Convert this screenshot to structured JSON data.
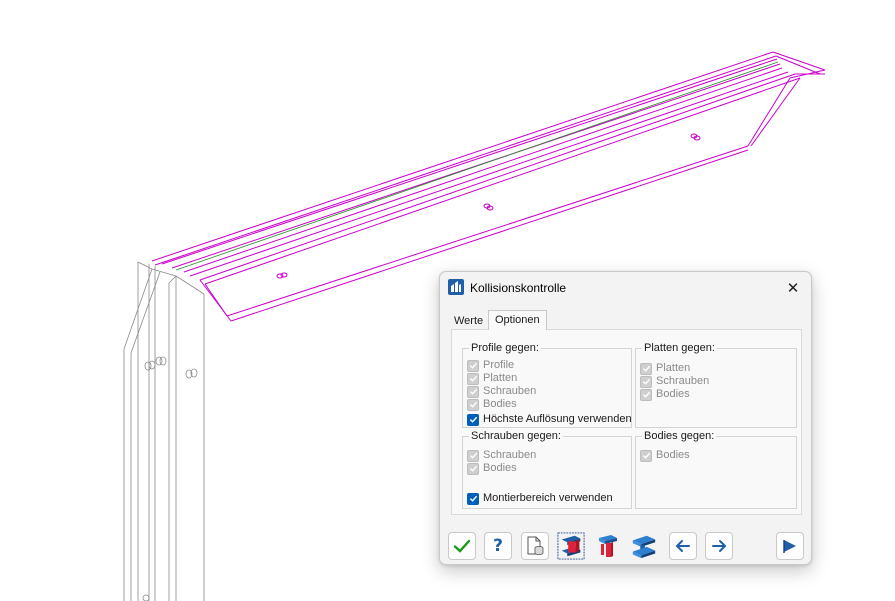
{
  "dialog": {
    "title": "Kollisionskontrolle",
    "close_glyph": "✕",
    "app_icon": "building-icon",
    "tabs": [
      {
        "label": "Werte",
        "active": false
      },
      {
        "label": "Optionen",
        "active": true
      }
    ],
    "groups": {
      "profile": {
        "title": "Profile gegen:",
        "items": [
          {
            "label": "Profile",
            "checked": true,
            "enabled": false
          },
          {
            "label": "Platten",
            "checked": true,
            "enabled": false
          },
          {
            "label": "Schrauben",
            "checked": true,
            "enabled": false
          },
          {
            "label": "Bodies",
            "checked": true,
            "enabled": false
          },
          {
            "label": "Höchste Auflösung verwenden",
            "checked": true,
            "enabled": true
          }
        ]
      },
      "platten": {
        "title": "Platten gegen:",
        "items": [
          {
            "label": "Platten",
            "checked": true,
            "enabled": false
          },
          {
            "label": "Schrauben",
            "checked": true,
            "enabled": false
          },
          {
            "label": "Bodies",
            "checked": true,
            "enabled": false
          }
        ]
      },
      "schrauben": {
        "title": "Schrauben gegen:",
        "items": [
          {
            "label": "Schrauben",
            "checked": true,
            "enabled": false
          },
          {
            "label": "Bodies",
            "checked": true,
            "enabled": false
          },
          {
            "label": "Montierbereich verwenden",
            "checked": true,
            "enabled": true
          }
        ]
      },
      "bodies": {
        "title": "Bodies gegen:",
        "items": [
          {
            "label": "Bodies",
            "checked": true,
            "enabled": false
          }
        ]
      }
    },
    "toolbar": {
      "help_label": "?",
      "buttons": [
        "ok-check-icon",
        "help-icon",
        "document-database-icon",
        "select-profile-red-icon",
        "bolt-icon",
        "select-profile-blue-icon",
        "arrow-left-icon",
        "arrow-right-icon",
        "flag-arrow-icon"
      ]
    }
  },
  "colors": {
    "highlight_magenta": "#cc00cc",
    "accent_blue": "#005fb8",
    "ok_green": "#1a9a1a"
  }
}
